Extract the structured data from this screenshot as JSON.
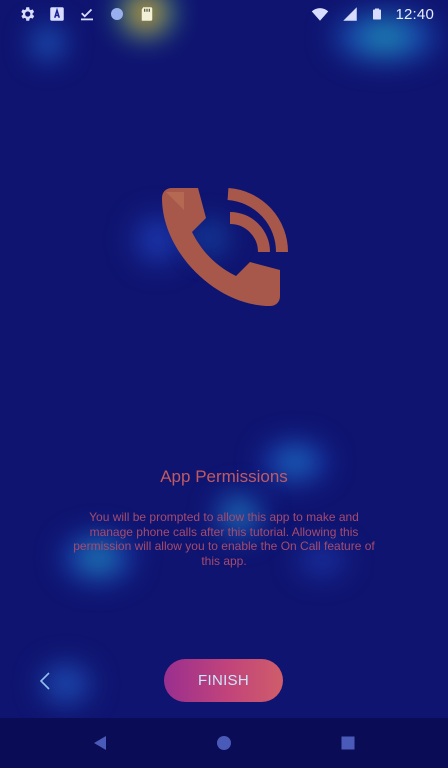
{
  "status_bar": {
    "time": "12:40",
    "left_icons": [
      "gear-icon",
      "font-a-icon",
      "check-download-icon",
      "circle-icon",
      "sd-card-icon"
    ],
    "right_icons": [
      "wifi-icon",
      "cellular-signal-icon",
      "battery-icon"
    ]
  },
  "main": {
    "hero_icon": "phone-ring-icon",
    "title": "App Permissions",
    "body": "You will be prompted to allow this app to make and manage phone calls after this tutorial. Allowing this permission will allow you to enable the On Call feature of this app."
  },
  "footer": {
    "back_icon": "chevron-left-icon",
    "finish_label": "FINISH"
  },
  "nav_bar": {
    "icons": [
      "back-triangle-icon",
      "home-circle-icon",
      "recents-square-icon"
    ]
  },
  "colors": {
    "background": "#0f1470",
    "title": "#c05a63",
    "body_text": "#a64b6d",
    "button_gradient_start": "#9a2f8f",
    "button_gradient_end": "#cf5d6a",
    "nav_bar": "#0a0c55"
  }
}
